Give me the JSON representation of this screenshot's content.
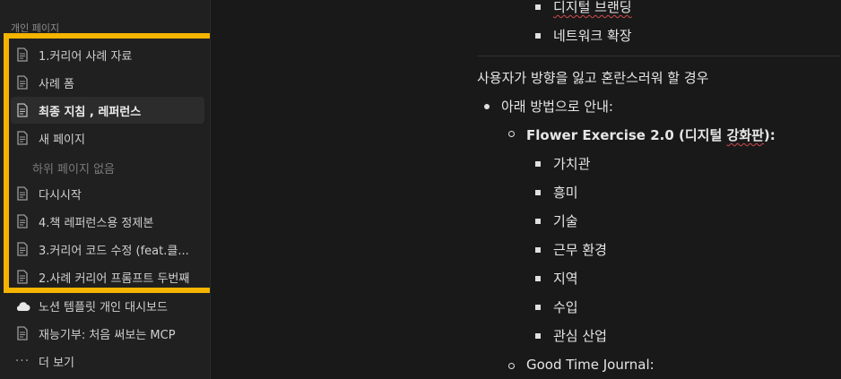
{
  "sidebar": {
    "section_label": "개인 페이지",
    "items": [
      {
        "label": "1.커리어 사례 자료",
        "icon": "page-icon"
      },
      {
        "label": "사례 폼",
        "icon": "page-icon"
      },
      {
        "label": "최종 지침 , 레퍼런스",
        "icon": "page-icon",
        "active": true
      },
      {
        "label": "새 페이지",
        "icon": "page-icon"
      },
      {
        "label": "다시시작",
        "icon": "page-icon"
      },
      {
        "label": "4.책 레퍼런스용 정제본",
        "icon": "page-icon"
      },
      {
        "label": "3.커리어 코드 수정 (feat.클...",
        "icon": "page-icon"
      },
      {
        "label": "2.사례 커리어 프롬프트 두번째",
        "icon": "page-icon"
      },
      {
        "label": "노션 템플릿 개인 대시보드",
        "icon": "cloud-icon"
      },
      {
        "label": "재능기부: 처음 써보는 MCP",
        "icon": "page-icon"
      }
    ],
    "empty_subpages": "하위 페이지 없음",
    "more_label": "더 보기",
    "highlight_color": "#f5b400"
  },
  "main": {
    "top_items": [
      "디지털 브랜딩",
      "네트워크 확장"
    ],
    "paragraph": "사용자가 방향을 잃고 혼란스러워 할 경우",
    "level1": "아래 방법으로 안내:",
    "flower_title_prefix": "Flower Exercise 2.0 (디지털 ",
    "flower_title_squiggle": "강화판",
    "flower_title_suffix": "):",
    "flower_items": [
      "가치관",
      "흥미",
      "기술",
      "근무 환경",
      "지역",
      "수입",
      "관심 산업"
    ],
    "good_time": "Good Time Journal:"
  }
}
